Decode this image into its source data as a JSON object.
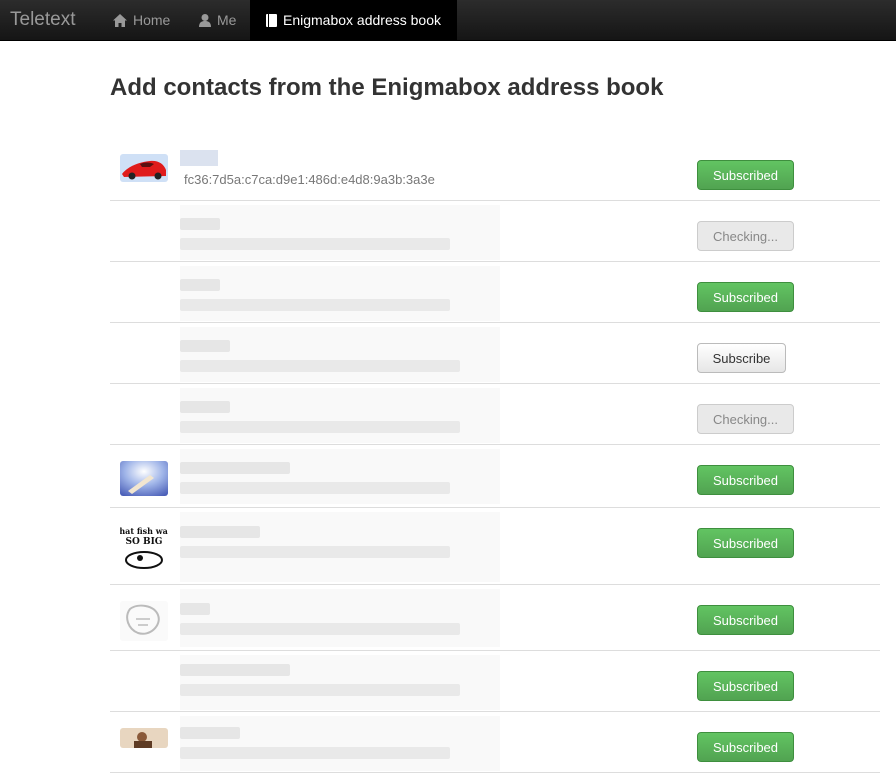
{
  "navbar": {
    "brand": "Teletext",
    "items": [
      {
        "label": "Home",
        "icon": "home-icon"
      },
      {
        "label": "Me",
        "icon": "user-icon"
      },
      {
        "label": "Enigmabox address book",
        "icon": "book-icon",
        "active": true
      }
    ]
  },
  "page": {
    "title": "Add contacts from the Enigmabox address book"
  },
  "contacts": [
    {
      "address": "fc36:7d5a:c7ca:d9e1:486d:e4d8:9a3b:3a3e",
      "button": "Subscribed",
      "status": "subscribed",
      "avatar": "sports-car-avatar"
    },
    {
      "button": "Checking...",
      "status": "checking"
    },
    {
      "button": "Subscribed",
      "status": "subscribed"
    },
    {
      "button": "Subscribe",
      "status": "unsubscribed"
    },
    {
      "button": "Checking...",
      "status": "checking"
    },
    {
      "button": "Subscribed",
      "status": "subscribed",
      "avatar": "sky-avatar"
    },
    {
      "button": "Subscribed",
      "status": "subscribed",
      "avatar": "fish-cartoon-avatar"
    },
    {
      "button": "Subscribed",
      "status": "subscribed",
      "avatar": "sketch-avatar"
    },
    {
      "button": "Subscribed",
      "status": "subscribed"
    },
    {
      "button": "Subscribed",
      "status": "subscribed",
      "avatar": "photo-avatar"
    }
  ],
  "colors": {
    "navbar": "#1b1b1b",
    "success": "#5bb75b",
    "text": "#333333"
  }
}
